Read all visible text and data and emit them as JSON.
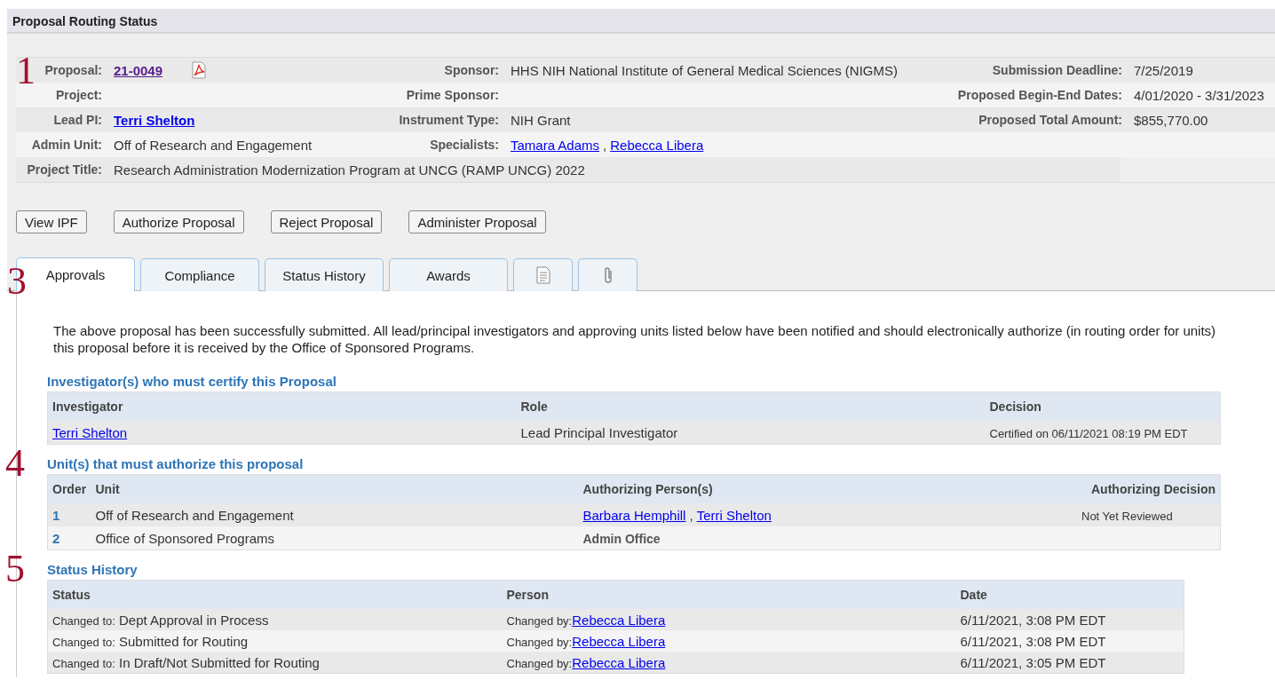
{
  "header": {
    "title": "Proposal Routing Status"
  },
  "info_panel": {
    "callout": "1",
    "rows": [
      {
        "cells": [
          {
            "label": "Proposal:",
            "parts": [
              {
                "text": "21-0049",
                "kind": "visited_link"
              },
              {
                "kind": "pdf"
              }
            ]
          },
          {
            "label": "Sponsor:",
            "parts": [
              {
                "text": "HHS NIH National Institute of General Medical Sciences (NIGMS)",
                "kind": "text"
              }
            ]
          },
          {
            "label": "Submission Deadline:",
            "parts": [
              {
                "text": "7/25/2019",
                "kind": "text"
              }
            ]
          }
        ]
      },
      {
        "cells": [
          {
            "label": "Project:"
          },
          {
            "label": "Prime Sponsor:"
          },
          {
            "label": "Proposed Begin-End Dates:",
            "parts": [
              {
                "text": "4/01/2020 - 3/31/2023",
                "kind": "text"
              }
            ]
          }
        ]
      },
      {
        "cells": [
          {
            "label": "Lead PI:",
            "parts": [
              {
                "text": "Terri Shelton",
                "kind": "bold_link"
              }
            ]
          },
          {
            "label": "Instrument Type:",
            "parts": [
              {
                "text": "NIH Grant",
                "kind": "text"
              }
            ]
          },
          {
            "label": "Proposed Total Amount:",
            "parts": [
              {
                "text": "$855,770.00",
                "kind": "text"
              }
            ]
          }
        ]
      },
      {
        "cells": [
          {
            "label": "Admin Unit:",
            "parts": [
              {
                "text": "Off of Research and Engagement",
                "kind": "text"
              }
            ]
          },
          {
            "label": "Specialists:",
            "parts": [
              {
                "text": "Tamara Adams ",
                "kind": "link"
              },
              {
                "text": ",",
                "kind": "text"
              },
              {
                "text": "Rebecca Libera",
                "kind": "link"
              }
            ]
          }
        ]
      },
      {
        "cells": [
          {
            "label": "Project Title:",
            "parts": [
              {
                "text": "Research Administration Modernization Program at UNCG (RAMP UNCG) 2022",
                "kind": "text"
              }
            ]
          }
        ]
      }
    ]
  },
  "buttons": [
    "View IPF",
    "Authorize Proposal",
    "Reject Proposal",
    "Administer Proposal"
  ],
  "tabs": {
    "callout": "3",
    "items": [
      {
        "kind": "text",
        "label": "Approvals",
        "selected": true
      },
      {
        "kind": "text",
        "label": "Compliance",
        "selected": false
      },
      {
        "kind": "text",
        "label": "Status History",
        "selected": false
      },
      {
        "kind": "text",
        "label": "Awards",
        "selected": false
      },
      {
        "kind": "document",
        "selected": false
      },
      {
        "kind": "attachment",
        "selected": false
      }
    ]
  },
  "intro": "The above proposal has been successfully submitted. All lead/principal investigators and approving units listed below have been notified and should electronically authorize (in routing order for units) this proposal before it is received by the Office of Sponsored Programs.",
  "investigators": {
    "heading": "Investigator(s) who must certify this Proposal",
    "columns": [
      "Investigator",
      "Role",
      "Decision"
    ],
    "rows": [
      {
        "investigator": "Terri Shelton",
        "role": "Lead Principal Investigator",
        "decision": "Certified on 06/11/2021 08:19 PM EDT"
      }
    ]
  },
  "units": {
    "callout": "4",
    "heading": "Unit(s) that must authorize this proposal",
    "columns": [
      "Order",
      "Unit",
      "Authorizing Person(s)",
      "Authorizing Decision"
    ],
    "rows": [
      {
        "order": "1",
        "unit": "Off of Research and Engagement",
        "persons": [
          {
            "text": "Barbara Hemphill",
            "kind": "link"
          },
          {
            "text": ",",
            "kind": "text"
          },
          {
            "text": "Terri Shelton",
            "kind": "link"
          }
        ],
        "decision": "Not Yet Reviewed"
      },
      {
        "order": "2",
        "unit": "Office of Sponsored Programs",
        "persons": [
          {
            "text": "Admin Office",
            "kind": "office"
          }
        ]
      }
    ]
  },
  "status_history": {
    "callout": "5",
    "heading": "Status History",
    "columns": [
      "Status",
      "Person",
      "Date"
    ],
    "rows": [
      {
        "status_prefix": "Changed to:",
        "status": "Dept Approval in Process",
        "person_prefix": "Changed by:",
        "person": "Rebecca Libera",
        "date": "6/11/2021, 3:08 PM EDT"
      },
      {
        "status_prefix": "Changed to:",
        "status": "Submitted for Routing",
        "person_prefix": "Changed by:",
        "person": "Rebecca Libera",
        "date": "6/11/2021, 3:08 PM EDT"
      },
      {
        "status_prefix": "Changed to:",
        "status": "In Draft/Not Submitted for Routing",
        "person_prefix": "Changed by:",
        "person": "Rebecca Libera",
        "date": "6/11/2021, 3:05 PM EDT"
      }
    ]
  }
}
